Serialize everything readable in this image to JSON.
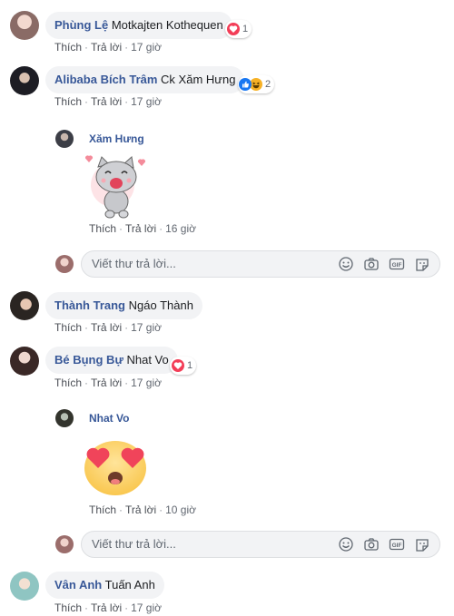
{
  "actions": {
    "like": "Thích",
    "reply": "Trả lời",
    "separator": "·"
  },
  "comments": [
    {
      "name": "Phùng Lệ",
      "text": "Motkajten Kothequen",
      "time": "17 giờ",
      "reaction_count": "1"
    },
    {
      "name": "Alibaba Bích Trâm",
      "text": "Ck Xăm Hưng",
      "time": "17 giờ",
      "reaction_count": "2"
    },
    {
      "name": "Thành Trang",
      "text": "Ngáo Thành",
      "time": "17 giờ"
    },
    {
      "name": "Bé Bụng Bự",
      "text": "Nhat Vo",
      "time": "17 giờ",
      "reaction_count": "1"
    },
    {
      "name": "Vân Anh",
      "text": "Tuấn Anh",
      "time": "17 giờ"
    }
  ],
  "replies": [
    {
      "name": "Xăm Hưng",
      "sticker": "cat-sticker",
      "time": "16 giờ"
    },
    {
      "name": "Nhat Vo",
      "sticker": "heart-eyes-emoji",
      "time": "10 giờ"
    }
  ],
  "reply_input": {
    "placeholder": "Viết thư trả lời..."
  },
  "colors": {
    "name": "#385898",
    "bubble": "#f2f3f5",
    "heart": "#f33e58",
    "like": "#1877f2",
    "haha": "#f7b125"
  }
}
